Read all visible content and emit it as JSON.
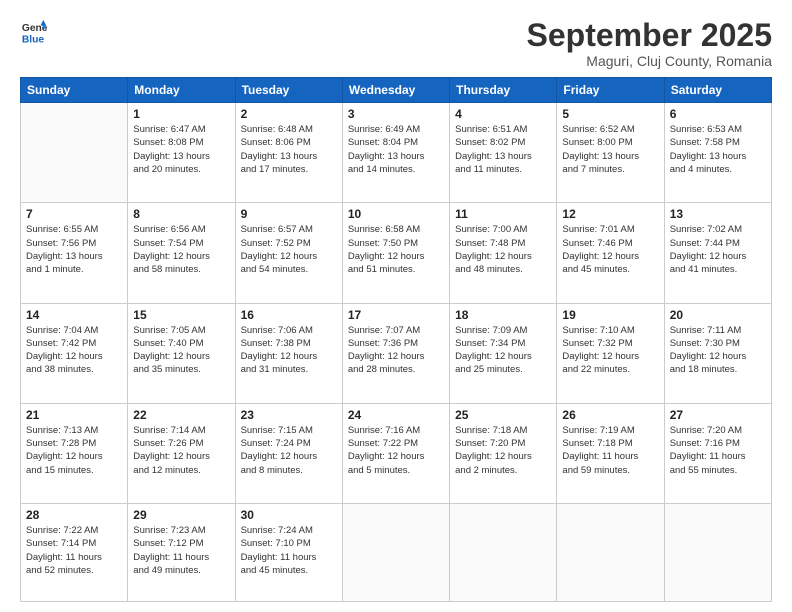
{
  "logo": {
    "line1": "General",
    "line2": "Blue"
  },
  "title": "September 2025",
  "location": "Maguri, Cluj County, Romania",
  "days_header": [
    "Sunday",
    "Monday",
    "Tuesday",
    "Wednesday",
    "Thursday",
    "Friday",
    "Saturday"
  ],
  "weeks": [
    [
      {
        "day": "",
        "info": ""
      },
      {
        "day": "1",
        "info": "Sunrise: 6:47 AM\nSunset: 8:08 PM\nDaylight: 13 hours\nand 20 minutes."
      },
      {
        "day": "2",
        "info": "Sunrise: 6:48 AM\nSunset: 8:06 PM\nDaylight: 13 hours\nand 17 minutes."
      },
      {
        "day": "3",
        "info": "Sunrise: 6:49 AM\nSunset: 8:04 PM\nDaylight: 13 hours\nand 14 minutes."
      },
      {
        "day": "4",
        "info": "Sunrise: 6:51 AM\nSunset: 8:02 PM\nDaylight: 13 hours\nand 11 minutes."
      },
      {
        "day": "5",
        "info": "Sunrise: 6:52 AM\nSunset: 8:00 PM\nDaylight: 13 hours\nand 7 minutes."
      },
      {
        "day": "6",
        "info": "Sunrise: 6:53 AM\nSunset: 7:58 PM\nDaylight: 13 hours\nand 4 minutes."
      }
    ],
    [
      {
        "day": "7",
        "info": "Sunrise: 6:55 AM\nSunset: 7:56 PM\nDaylight: 13 hours\nand 1 minute."
      },
      {
        "day": "8",
        "info": "Sunrise: 6:56 AM\nSunset: 7:54 PM\nDaylight: 12 hours\nand 58 minutes."
      },
      {
        "day": "9",
        "info": "Sunrise: 6:57 AM\nSunset: 7:52 PM\nDaylight: 12 hours\nand 54 minutes."
      },
      {
        "day": "10",
        "info": "Sunrise: 6:58 AM\nSunset: 7:50 PM\nDaylight: 12 hours\nand 51 minutes."
      },
      {
        "day": "11",
        "info": "Sunrise: 7:00 AM\nSunset: 7:48 PM\nDaylight: 12 hours\nand 48 minutes."
      },
      {
        "day": "12",
        "info": "Sunrise: 7:01 AM\nSunset: 7:46 PM\nDaylight: 12 hours\nand 45 minutes."
      },
      {
        "day": "13",
        "info": "Sunrise: 7:02 AM\nSunset: 7:44 PM\nDaylight: 12 hours\nand 41 minutes."
      }
    ],
    [
      {
        "day": "14",
        "info": "Sunrise: 7:04 AM\nSunset: 7:42 PM\nDaylight: 12 hours\nand 38 minutes."
      },
      {
        "day": "15",
        "info": "Sunrise: 7:05 AM\nSunset: 7:40 PM\nDaylight: 12 hours\nand 35 minutes."
      },
      {
        "day": "16",
        "info": "Sunrise: 7:06 AM\nSunset: 7:38 PM\nDaylight: 12 hours\nand 31 minutes."
      },
      {
        "day": "17",
        "info": "Sunrise: 7:07 AM\nSunset: 7:36 PM\nDaylight: 12 hours\nand 28 minutes."
      },
      {
        "day": "18",
        "info": "Sunrise: 7:09 AM\nSunset: 7:34 PM\nDaylight: 12 hours\nand 25 minutes."
      },
      {
        "day": "19",
        "info": "Sunrise: 7:10 AM\nSunset: 7:32 PM\nDaylight: 12 hours\nand 22 minutes."
      },
      {
        "day": "20",
        "info": "Sunrise: 7:11 AM\nSunset: 7:30 PM\nDaylight: 12 hours\nand 18 minutes."
      }
    ],
    [
      {
        "day": "21",
        "info": "Sunrise: 7:13 AM\nSunset: 7:28 PM\nDaylight: 12 hours\nand 15 minutes."
      },
      {
        "day": "22",
        "info": "Sunrise: 7:14 AM\nSunset: 7:26 PM\nDaylight: 12 hours\nand 12 minutes."
      },
      {
        "day": "23",
        "info": "Sunrise: 7:15 AM\nSunset: 7:24 PM\nDaylight: 12 hours\nand 8 minutes."
      },
      {
        "day": "24",
        "info": "Sunrise: 7:16 AM\nSunset: 7:22 PM\nDaylight: 12 hours\nand 5 minutes."
      },
      {
        "day": "25",
        "info": "Sunrise: 7:18 AM\nSunset: 7:20 PM\nDaylight: 12 hours\nand 2 minutes."
      },
      {
        "day": "26",
        "info": "Sunrise: 7:19 AM\nSunset: 7:18 PM\nDaylight: 11 hours\nand 59 minutes."
      },
      {
        "day": "27",
        "info": "Sunrise: 7:20 AM\nSunset: 7:16 PM\nDaylight: 11 hours\nand 55 minutes."
      }
    ],
    [
      {
        "day": "28",
        "info": "Sunrise: 7:22 AM\nSunset: 7:14 PM\nDaylight: 11 hours\nand 52 minutes."
      },
      {
        "day": "29",
        "info": "Sunrise: 7:23 AM\nSunset: 7:12 PM\nDaylight: 11 hours\nand 49 minutes."
      },
      {
        "day": "30",
        "info": "Sunrise: 7:24 AM\nSunset: 7:10 PM\nDaylight: 11 hours\nand 45 minutes."
      },
      {
        "day": "",
        "info": ""
      },
      {
        "day": "",
        "info": ""
      },
      {
        "day": "",
        "info": ""
      },
      {
        "day": "",
        "info": ""
      }
    ]
  ]
}
